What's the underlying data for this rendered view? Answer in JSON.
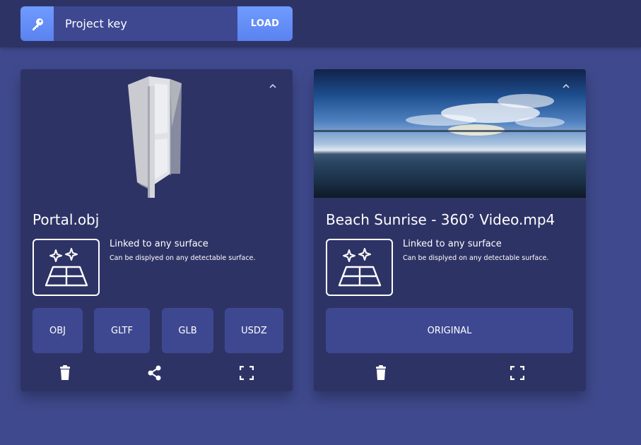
{
  "header": {
    "key_placeholder": "Project key",
    "load_label": "LOAD"
  },
  "cards": [
    {
      "title": "Portal.obj",
      "surface_title": "Linked to any surface",
      "surface_sub": "Can be displyed on any detectable surface.",
      "formats": [
        "OBJ",
        "GLTF",
        "GLB",
        "USDZ"
      ]
    },
    {
      "title": "Beach Sunrise - 360° Video.mp4",
      "surface_title": "Linked to any surface",
      "surface_sub": "Can be displyed on any detectable surface.",
      "formats": [
        "ORIGINAL"
      ]
    }
  ],
  "colors": {
    "background": "#3f4a8e",
    "topbar": "#2e3366",
    "card": "#2e3366",
    "button": "#3e4891",
    "accent": "#6f9bff"
  },
  "icons": [
    "key-icon",
    "chevron-up-icon",
    "sparkle-icon",
    "surface-grid-icon",
    "trash-icon",
    "share-icon",
    "fullscreen-icon"
  ]
}
